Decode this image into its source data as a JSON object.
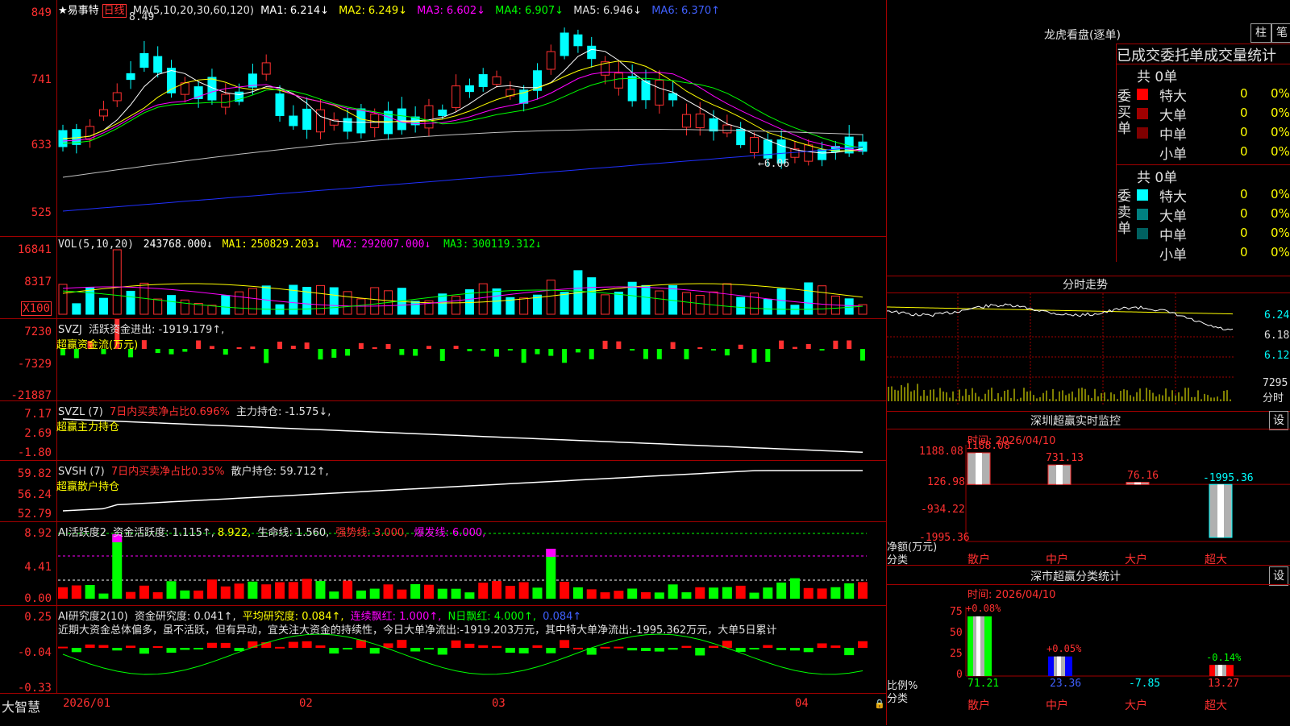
{
  "price_pane": {
    "title": "★易事特",
    "period": "日线",
    "ma_label": "MA(5,10,20,30,60,120)",
    "ma": [
      {
        "label": "MA1:",
        "value": "6.214↓",
        "color": "#ffffff"
      },
      {
        "label": "MA2:",
        "value": "6.249↓",
        "color": "#ffff00"
      },
      {
        "label": "MA3:",
        "value": "6.602↓",
        "color": "#ff00ff"
      },
      {
        "label": "MA4:",
        "value": "6.907↓",
        "color": "#00ff00"
      },
      {
        "label": "MA5:",
        "value": "6.946↓",
        "color": "#c0c0c0"
      },
      {
        "label": "MA6:",
        "value": "6.370↑",
        "color": "#0000ff"
      }
    ],
    "y_labels": [
      "849",
      "741",
      "633",
      "525"
    ],
    "high_note": "8.49",
    "low_note": "←6.06"
  },
  "vol_pane": {
    "label": "VOL(5,10,20)",
    "value": "243768.000↓",
    "ma": [
      {
        "label": "MA1:",
        "value": "250829.203↓",
        "color": "#ffff00"
      },
      {
        "label": "MA2:",
        "value": "292007.000↓",
        "color": "#ff00ff"
      },
      {
        "label": "MA3:",
        "value": "300119.312↓",
        "color": "#00ff00"
      }
    ],
    "y_labels": [
      "16841",
      "8317"
    ],
    "unit": "X100"
  },
  "svzj_pane": {
    "label": "SVZJ",
    "text": "活跃资金进出: -1919.179↑,",
    "sub": "超赢资金流(万元)",
    "y_labels": [
      "7230",
      "-7329",
      "-21887"
    ]
  },
  "svzl_pane": {
    "label": "SVZL (7)",
    "red": "7日内买卖净占比0.696%",
    "text": "主力持仓: -1.575↓,",
    "sub": "超赢主力持仓",
    "y_labels": [
      "7.17",
      "2.69",
      "-1.80"
    ]
  },
  "svsh_pane": {
    "label": "SVSH (7)",
    "red": "7日内买卖净占比0.35%",
    "text": "散户持仓: 59.712↑,",
    "sub": "超赢散户持仓",
    "y_labels": [
      "59.82",
      "56.24",
      "52.79"
    ]
  },
  "ai2_pane": {
    "label": "AI活跃度2",
    "t1": "资金活跃度: 1.115↑,",
    "t2": "8.922,",
    "t3": "生命线: 1.560,",
    "t4": "强势线: 3.000,",
    "t5": "爆发线: 6.000,",
    "y_labels": [
      "8.92",
      "4.41",
      "0.00"
    ]
  },
  "ai_research_pane": {
    "label": "AI研究度2(10)",
    "t1": "资金研究度: 0.041↑,",
    "t2": "平均研究度: 0.084↑,",
    "t3": "连续飘红: 1.000↑,",
    "t4": "N日飘红: 4.000↑,",
    "t5": "0.084↑",
    "note": "近期大资金总体偏多，虽不活跃，但有异动，宜关注大资金的持续性，今日大单净流出:-1919.203万元，其中特大单净流出:-1995.362万元，大单5日累计",
    "y_labels": [
      "0.25",
      "-0.04",
      "-0.33"
    ]
  },
  "x_axis": {
    "labels": [
      "2026/01",
      "02",
      "03",
      "04"
    ],
    "brand": "大智慧"
  },
  "dragon_tiger": {
    "title": "龙虎看盘(逐单)",
    "btn_bar": "柱",
    "btn_pen": "笔",
    "tabs": [
      "已成交",
      "委托单",
      "成交量统计"
    ],
    "buy": {
      "side": "委买单",
      "total": "共 0单",
      "rows": [
        {
          "name": "特大",
          "count": "0",
          "pct": "0%",
          "color": "#ff0000"
        },
        {
          "name": "大单",
          "count": "0",
          "pct": "0%",
          "color": "#a00000"
        },
        {
          "name": "中单",
          "count": "0",
          "pct": "0%",
          "color": "#800000"
        },
        {
          "name": "小单",
          "count": "0",
          "pct": "0%",
          "color": "#000000"
        }
      ]
    },
    "sell": {
      "side": "委卖单",
      "total": "共 0单",
      "rows": [
        {
          "name": "特大",
          "count": "0",
          "pct": "0%",
          "color": "#00ffff"
        },
        {
          "name": "大单",
          "count": "0",
          "pct": "0%",
          "color": "#008080"
        },
        {
          "name": "中单",
          "count": "0",
          "pct": "0%",
          "color": "#006060"
        },
        {
          "name": "小单",
          "count": "0",
          "pct": "0%",
          "color": "#000000"
        }
      ]
    }
  },
  "intraday": {
    "title": "分时走势",
    "y_labels": [
      "6.24",
      "6.18",
      "6.12"
    ],
    "vol_label": "7295",
    "vol_unit": "分时"
  },
  "sz_monitor": {
    "title": "深圳超赢实时监控",
    "btn": "设",
    "date": "时间: 2026/04/10",
    "y_labels": [
      "1188.08",
      "126.98",
      "-934.22",
      "-1995.36"
    ],
    "y_unit": "净额(万元)",
    "x_unit": "分类",
    "categories": [
      "散户",
      "中户",
      "大户",
      "超大"
    ],
    "values": [
      1188.08,
      731.13,
      76.16,
      -1995.36
    ],
    "value_labels": [
      "1188.08",
      "731.13",
      "76.16",
      "-1995.36"
    ]
  },
  "sz_stats": {
    "title": "深市超赢分类统计",
    "btn": "设",
    "date": "时间: 2026/04/10",
    "y_labels": [
      "75",
      "50",
      "25",
      "0"
    ],
    "y_unit": "比例%",
    "x_unit": "分类",
    "categories": [
      "散户",
      "中户",
      "大户",
      "超大"
    ],
    "values": [
      71.21,
      23.36,
      -7.85,
      13.27
    ],
    "change_labels": [
      "+0.08%",
      "+0.05%",
      "",
      "-0.14%"
    ],
    "value_labels": [
      "71.21",
      "23.36",
      "-7.85",
      "13.27"
    ]
  }
}
